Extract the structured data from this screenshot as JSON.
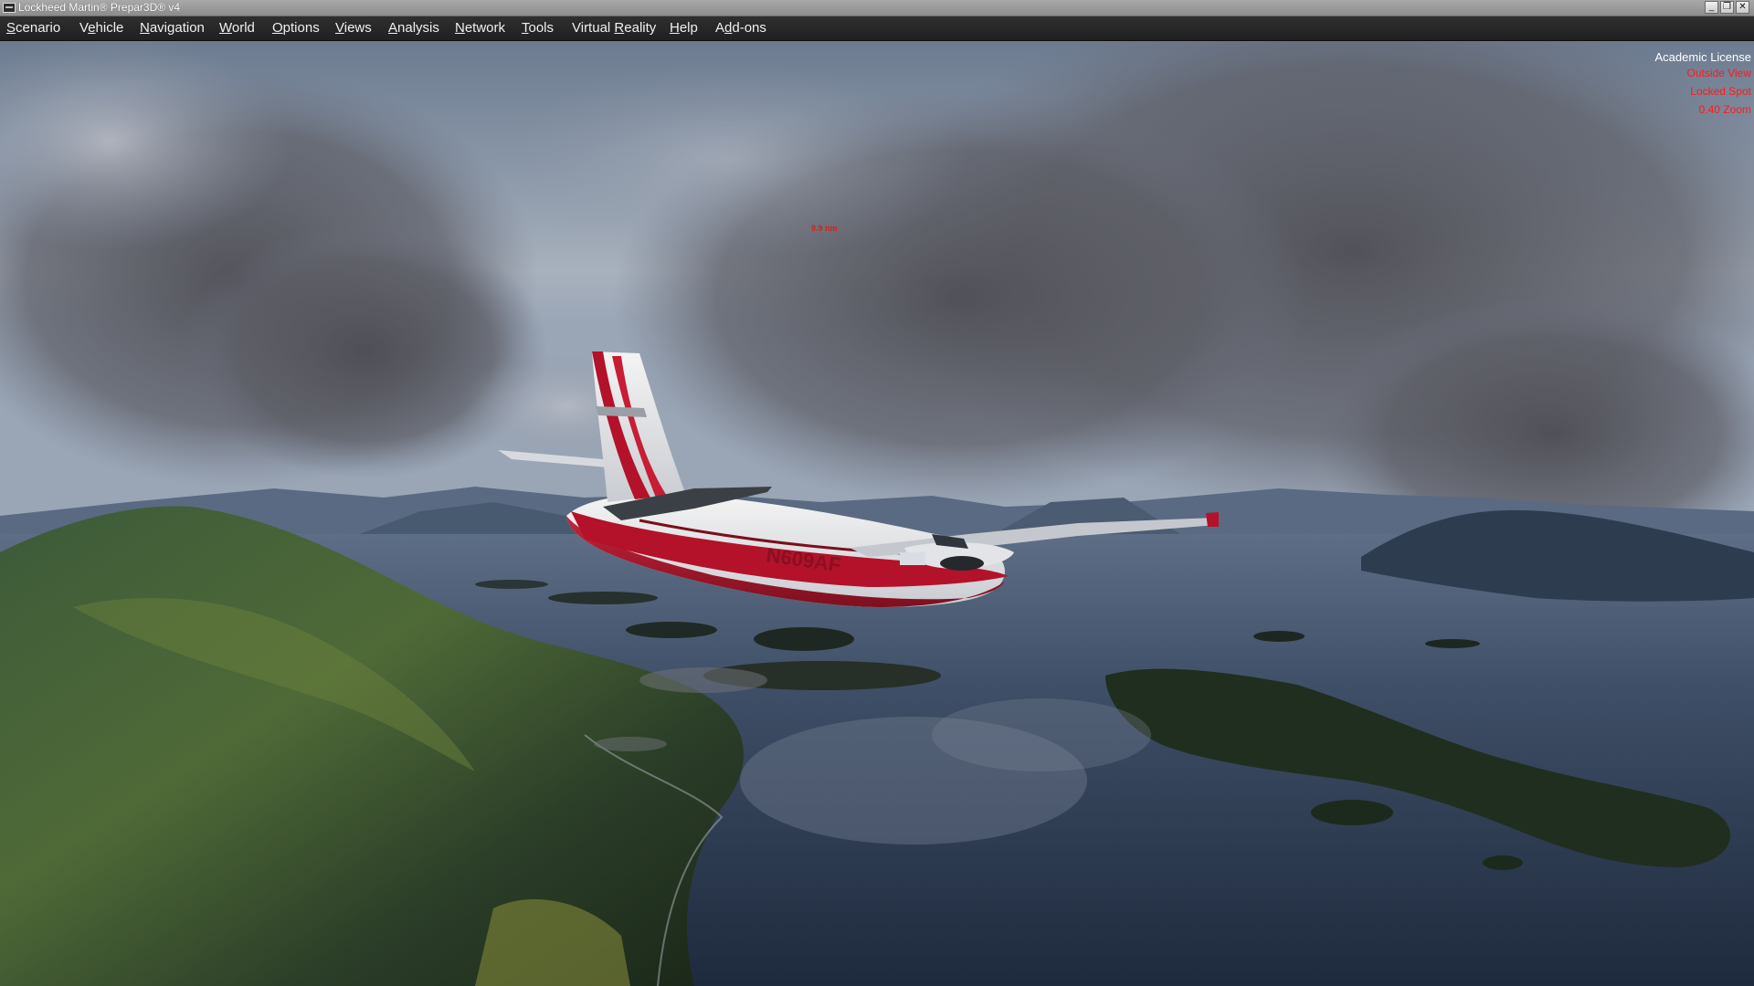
{
  "window": {
    "title": "Lockheed Martin® Prepar3D® v4",
    "controls": {
      "minimize": "_",
      "restore": "❐",
      "close": "✕"
    }
  },
  "menu": {
    "items": [
      {
        "label_pre": "",
        "label_u": "S",
        "label_post": "cenario"
      },
      {
        "label_pre": "V",
        "label_u": "e",
        "label_post": "hicle"
      },
      {
        "label_pre": "",
        "label_u": "N",
        "label_post": "avigation"
      },
      {
        "label_pre": "",
        "label_u": "W",
        "label_post": "orld"
      },
      {
        "label_pre": "",
        "label_u": "O",
        "label_post": "ptions"
      },
      {
        "label_pre": "",
        "label_u": "V",
        "label_post": "iews"
      },
      {
        "label_pre": "",
        "label_u": "A",
        "label_post": "nalysis"
      },
      {
        "label_pre": "",
        "label_u": "N",
        "label_post": "etwork"
      },
      {
        "label_pre": "",
        "label_u": "T",
        "label_post": "ools"
      },
      {
        "label_pre": "Virtual ",
        "label_u": "R",
        "label_post": "eality"
      },
      {
        "label_pre": "",
        "label_u": "H",
        "label_post": "elp"
      },
      {
        "label_pre": "A",
        "label_u": "d",
        "label_post": "d-ons"
      }
    ]
  },
  "overlay": {
    "license": "Academic License",
    "view_mode": "Outside View",
    "camera": "Locked Spot",
    "zoom": "0.40 Zoom",
    "distance": "9.9 nm"
  },
  "aircraft": {
    "registration": "N609AF",
    "livery_colors": {
      "body": "#eeeeee",
      "stripe": "#b3122a"
    }
  },
  "colors": {
    "menubar": "#262626",
    "titlebar": "#9a9a9a",
    "overlay_red": "#ff1a1a"
  }
}
